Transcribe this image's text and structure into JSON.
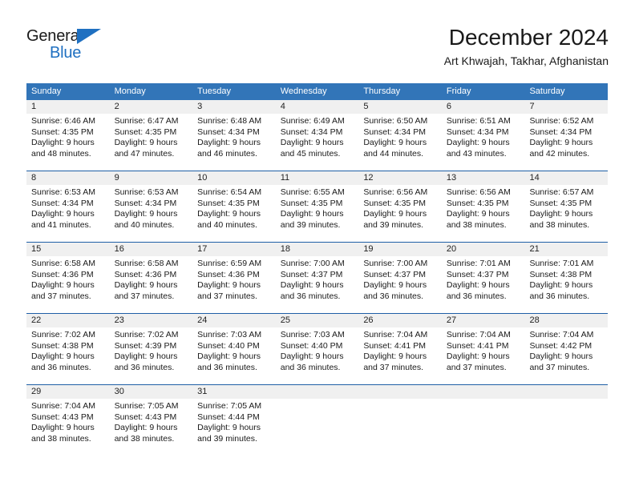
{
  "brand": {
    "logo_general": "General",
    "logo_blue": "Blue",
    "logo_icon": "triangle-icon",
    "accent_color": "#1f70c1"
  },
  "header": {
    "title": "December 2024",
    "subtitle": "Art Khwajah, Takhar, Afghanistan"
  },
  "colors": {
    "header_blue": "#3275b8",
    "separator_blue": "#1f5fa6",
    "day_band_gray": "#f0f0f0",
    "text": "#1a1a1a"
  },
  "weekdays": [
    "Sunday",
    "Monday",
    "Tuesday",
    "Wednesday",
    "Thursday",
    "Friday",
    "Saturday"
  ],
  "weeks": [
    [
      {
        "day": "1",
        "sunrise": "Sunrise: 6:46 AM",
        "sunset": "Sunset: 4:35 PM",
        "daylight1": "Daylight: 9 hours",
        "daylight2": "and 48 minutes."
      },
      {
        "day": "2",
        "sunrise": "Sunrise: 6:47 AM",
        "sunset": "Sunset: 4:35 PM",
        "daylight1": "Daylight: 9 hours",
        "daylight2": "and 47 minutes."
      },
      {
        "day": "3",
        "sunrise": "Sunrise: 6:48 AM",
        "sunset": "Sunset: 4:34 PM",
        "daylight1": "Daylight: 9 hours",
        "daylight2": "and 46 minutes."
      },
      {
        "day": "4",
        "sunrise": "Sunrise: 6:49 AM",
        "sunset": "Sunset: 4:34 PM",
        "daylight1": "Daylight: 9 hours",
        "daylight2": "and 45 minutes."
      },
      {
        "day": "5",
        "sunrise": "Sunrise: 6:50 AM",
        "sunset": "Sunset: 4:34 PM",
        "daylight1": "Daylight: 9 hours",
        "daylight2": "and 44 minutes."
      },
      {
        "day": "6",
        "sunrise": "Sunrise: 6:51 AM",
        "sunset": "Sunset: 4:34 PM",
        "daylight1": "Daylight: 9 hours",
        "daylight2": "and 43 minutes."
      },
      {
        "day": "7",
        "sunrise": "Sunrise: 6:52 AM",
        "sunset": "Sunset: 4:34 PM",
        "daylight1": "Daylight: 9 hours",
        "daylight2": "and 42 minutes."
      }
    ],
    [
      {
        "day": "8",
        "sunrise": "Sunrise: 6:53 AM",
        "sunset": "Sunset: 4:34 PM",
        "daylight1": "Daylight: 9 hours",
        "daylight2": "and 41 minutes."
      },
      {
        "day": "9",
        "sunrise": "Sunrise: 6:53 AM",
        "sunset": "Sunset: 4:34 PM",
        "daylight1": "Daylight: 9 hours",
        "daylight2": "and 40 minutes."
      },
      {
        "day": "10",
        "sunrise": "Sunrise: 6:54 AM",
        "sunset": "Sunset: 4:35 PM",
        "daylight1": "Daylight: 9 hours",
        "daylight2": "and 40 minutes."
      },
      {
        "day": "11",
        "sunrise": "Sunrise: 6:55 AM",
        "sunset": "Sunset: 4:35 PM",
        "daylight1": "Daylight: 9 hours",
        "daylight2": "and 39 minutes."
      },
      {
        "day": "12",
        "sunrise": "Sunrise: 6:56 AM",
        "sunset": "Sunset: 4:35 PM",
        "daylight1": "Daylight: 9 hours",
        "daylight2": "and 39 minutes."
      },
      {
        "day": "13",
        "sunrise": "Sunrise: 6:56 AM",
        "sunset": "Sunset: 4:35 PM",
        "daylight1": "Daylight: 9 hours",
        "daylight2": "and 38 minutes."
      },
      {
        "day": "14",
        "sunrise": "Sunrise: 6:57 AM",
        "sunset": "Sunset: 4:35 PM",
        "daylight1": "Daylight: 9 hours",
        "daylight2": "and 38 minutes."
      }
    ],
    [
      {
        "day": "15",
        "sunrise": "Sunrise: 6:58 AM",
        "sunset": "Sunset: 4:36 PM",
        "daylight1": "Daylight: 9 hours",
        "daylight2": "and 37 minutes."
      },
      {
        "day": "16",
        "sunrise": "Sunrise: 6:58 AM",
        "sunset": "Sunset: 4:36 PM",
        "daylight1": "Daylight: 9 hours",
        "daylight2": "and 37 minutes."
      },
      {
        "day": "17",
        "sunrise": "Sunrise: 6:59 AM",
        "sunset": "Sunset: 4:36 PM",
        "daylight1": "Daylight: 9 hours",
        "daylight2": "and 37 minutes."
      },
      {
        "day": "18",
        "sunrise": "Sunrise: 7:00 AM",
        "sunset": "Sunset: 4:37 PM",
        "daylight1": "Daylight: 9 hours",
        "daylight2": "and 36 minutes."
      },
      {
        "day": "19",
        "sunrise": "Sunrise: 7:00 AM",
        "sunset": "Sunset: 4:37 PM",
        "daylight1": "Daylight: 9 hours",
        "daylight2": "and 36 minutes."
      },
      {
        "day": "20",
        "sunrise": "Sunrise: 7:01 AM",
        "sunset": "Sunset: 4:37 PM",
        "daylight1": "Daylight: 9 hours",
        "daylight2": "and 36 minutes."
      },
      {
        "day": "21",
        "sunrise": "Sunrise: 7:01 AM",
        "sunset": "Sunset: 4:38 PM",
        "daylight1": "Daylight: 9 hours",
        "daylight2": "and 36 minutes."
      }
    ],
    [
      {
        "day": "22",
        "sunrise": "Sunrise: 7:02 AM",
        "sunset": "Sunset: 4:38 PM",
        "daylight1": "Daylight: 9 hours",
        "daylight2": "and 36 minutes."
      },
      {
        "day": "23",
        "sunrise": "Sunrise: 7:02 AM",
        "sunset": "Sunset: 4:39 PM",
        "daylight1": "Daylight: 9 hours",
        "daylight2": "and 36 minutes."
      },
      {
        "day": "24",
        "sunrise": "Sunrise: 7:03 AM",
        "sunset": "Sunset: 4:40 PM",
        "daylight1": "Daylight: 9 hours",
        "daylight2": "and 36 minutes."
      },
      {
        "day": "25",
        "sunrise": "Sunrise: 7:03 AM",
        "sunset": "Sunset: 4:40 PM",
        "daylight1": "Daylight: 9 hours",
        "daylight2": "and 36 minutes."
      },
      {
        "day": "26",
        "sunrise": "Sunrise: 7:04 AM",
        "sunset": "Sunset: 4:41 PM",
        "daylight1": "Daylight: 9 hours",
        "daylight2": "and 37 minutes."
      },
      {
        "day": "27",
        "sunrise": "Sunrise: 7:04 AM",
        "sunset": "Sunset: 4:41 PM",
        "daylight1": "Daylight: 9 hours",
        "daylight2": "and 37 minutes."
      },
      {
        "day": "28",
        "sunrise": "Sunrise: 7:04 AM",
        "sunset": "Sunset: 4:42 PM",
        "daylight1": "Daylight: 9 hours",
        "daylight2": "and 37 minutes."
      }
    ],
    [
      {
        "day": "29",
        "sunrise": "Sunrise: 7:04 AM",
        "sunset": "Sunset: 4:43 PM",
        "daylight1": "Daylight: 9 hours",
        "daylight2": "and 38 minutes."
      },
      {
        "day": "30",
        "sunrise": "Sunrise: 7:05 AM",
        "sunset": "Sunset: 4:43 PM",
        "daylight1": "Daylight: 9 hours",
        "daylight2": "and 38 minutes."
      },
      {
        "day": "31",
        "sunrise": "Sunrise: 7:05 AM",
        "sunset": "Sunset: 4:44 PM",
        "daylight1": "Daylight: 9 hours",
        "daylight2": "and 39 minutes."
      },
      {
        "day": "",
        "sunrise": "",
        "sunset": "",
        "daylight1": "",
        "daylight2": ""
      },
      {
        "day": "",
        "sunrise": "",
        "sunset": "",
        "daylight1": "",
        "daylight2": ""
      },
      {
        "day": "",
        "sunrise": "",
        "sunset": "",
        "daylight1": "",
        "daylight2": ""
      },
      {
        "day": "",
        "sunrise": "",
        "sunset": "",
        "daylight1": "",
        "daylight2": ""
      }
    ]
  ]
}
